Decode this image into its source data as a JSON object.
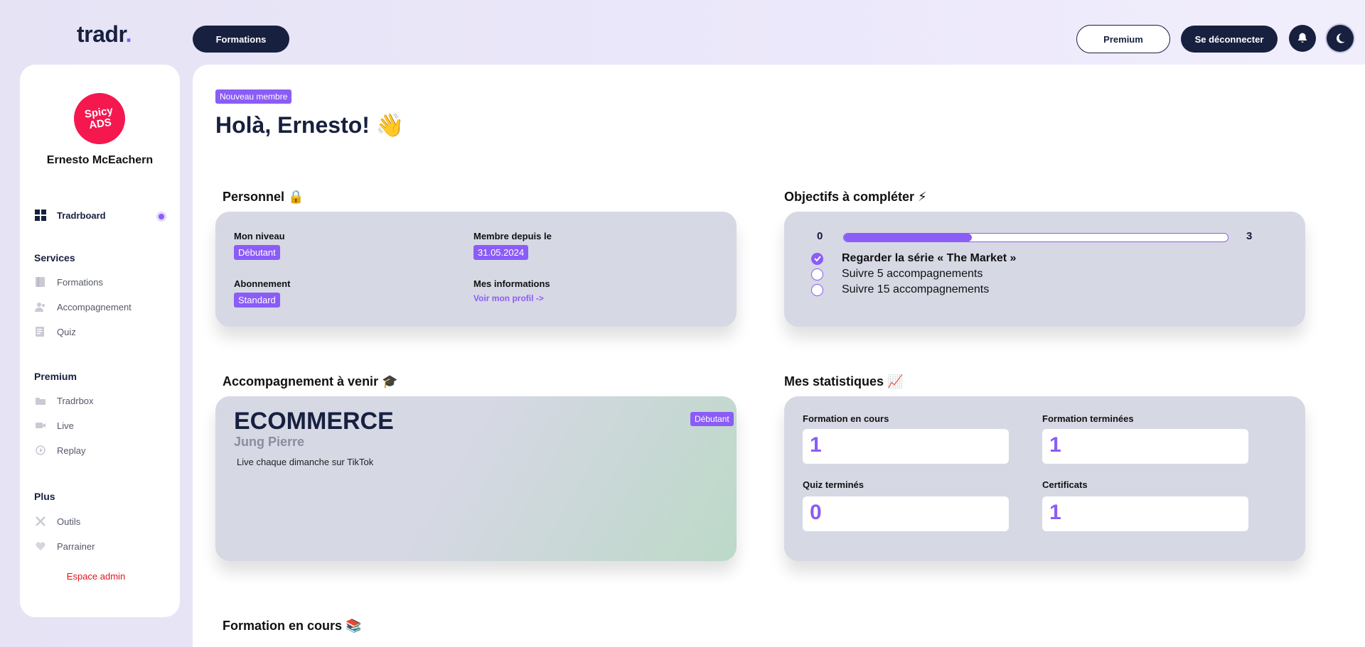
{
  "header": {
    "logo_text": "tradr",
    "logo_dot": ".",
    "formations_button": "Formations",
    "premium_button": "Premium",
    "logout_button": "Se déconnecter"
  },
  "sidebar": {
    "avatar_line1": "Spicy",
    "avatar_line2": "ADS",
    "user_name": "Ernesto McEachern",
    "active_item": "Tradrboard",
    "sections": [
      {
        "title": "Services",
        "items": [
          "Formations",
          "Accompagnement",
          "Quiz"
        ]
      },
      {
        "title": "Premium",
        "items": [
          "Tradrbox",
          "Live",
          "Replay"
        ]
      },
      {
        "title": "Plus",
        "items": [
          "Outils",
          "Parrainer"
        ]
      }
    ],
    "admin_link": "Espace admin"
  },
  "main": {
    "member_badge": "Nouveau membre",
    "greeting": "Holà, Ernesto! 👋",
    "personnel": {
      "title": "Personnel 🔒",
      "niveau_label": "Mon niveau",
      "niveau_value": "Débutant",
      "membre_label": "Membre depuis le",
      "membre_value": "31.05.2024",
      "abonnement_label": "Abonnement",
      "abonnement_value": "Standard",
      "infos_label": "Mes informations",
      "infos_link": "Voir mon profil ->"
    },
    "objectifs": {
      "title": "Objectifs à compléter ⚡",
      "min": "0",
      "max": "3",
      "progress": 0.333,
      "goals": [
        {
          "label": "Regarder la série « The Market »",
          "done": true
        },
        {
          "label": "Suivre 5 accompagnements",
          "done": false
        },
        {
          "label": "Suivre 15 accompagnements",
          "done": false
        }
      ]
    },
    "accompagnement": {
      "title": "Accompagnement à venir 🎓",
      "name": "ECOMMERCE",
      "coach": "Jung Pierre",
      "level": "Débutant",
      "description": "Live chaque dimanche sur TikTok"
    },
    "statistiques": {
      "title": "Mes statistiques 📈",
      "items": [
        {
          "label": "Formation en cours",
          "value": "1"
        },
        {
          "label": "Formation terminées",
          "value": "1"
        },
        {
          "label": "Quiz terminés",
          "value": "0"
        },
        {
          "label": "Certificats",
          "value": "1"
        }
      ]
    },
    "formation_en_cours_title": "Formation en cours 📚"
  },
  "colors": {
    "accent": "#8b5cf6",
    "navy": "#17203f",
    "card": "#d6d8e4",
    "admin": "#e0141e"
  }
}
